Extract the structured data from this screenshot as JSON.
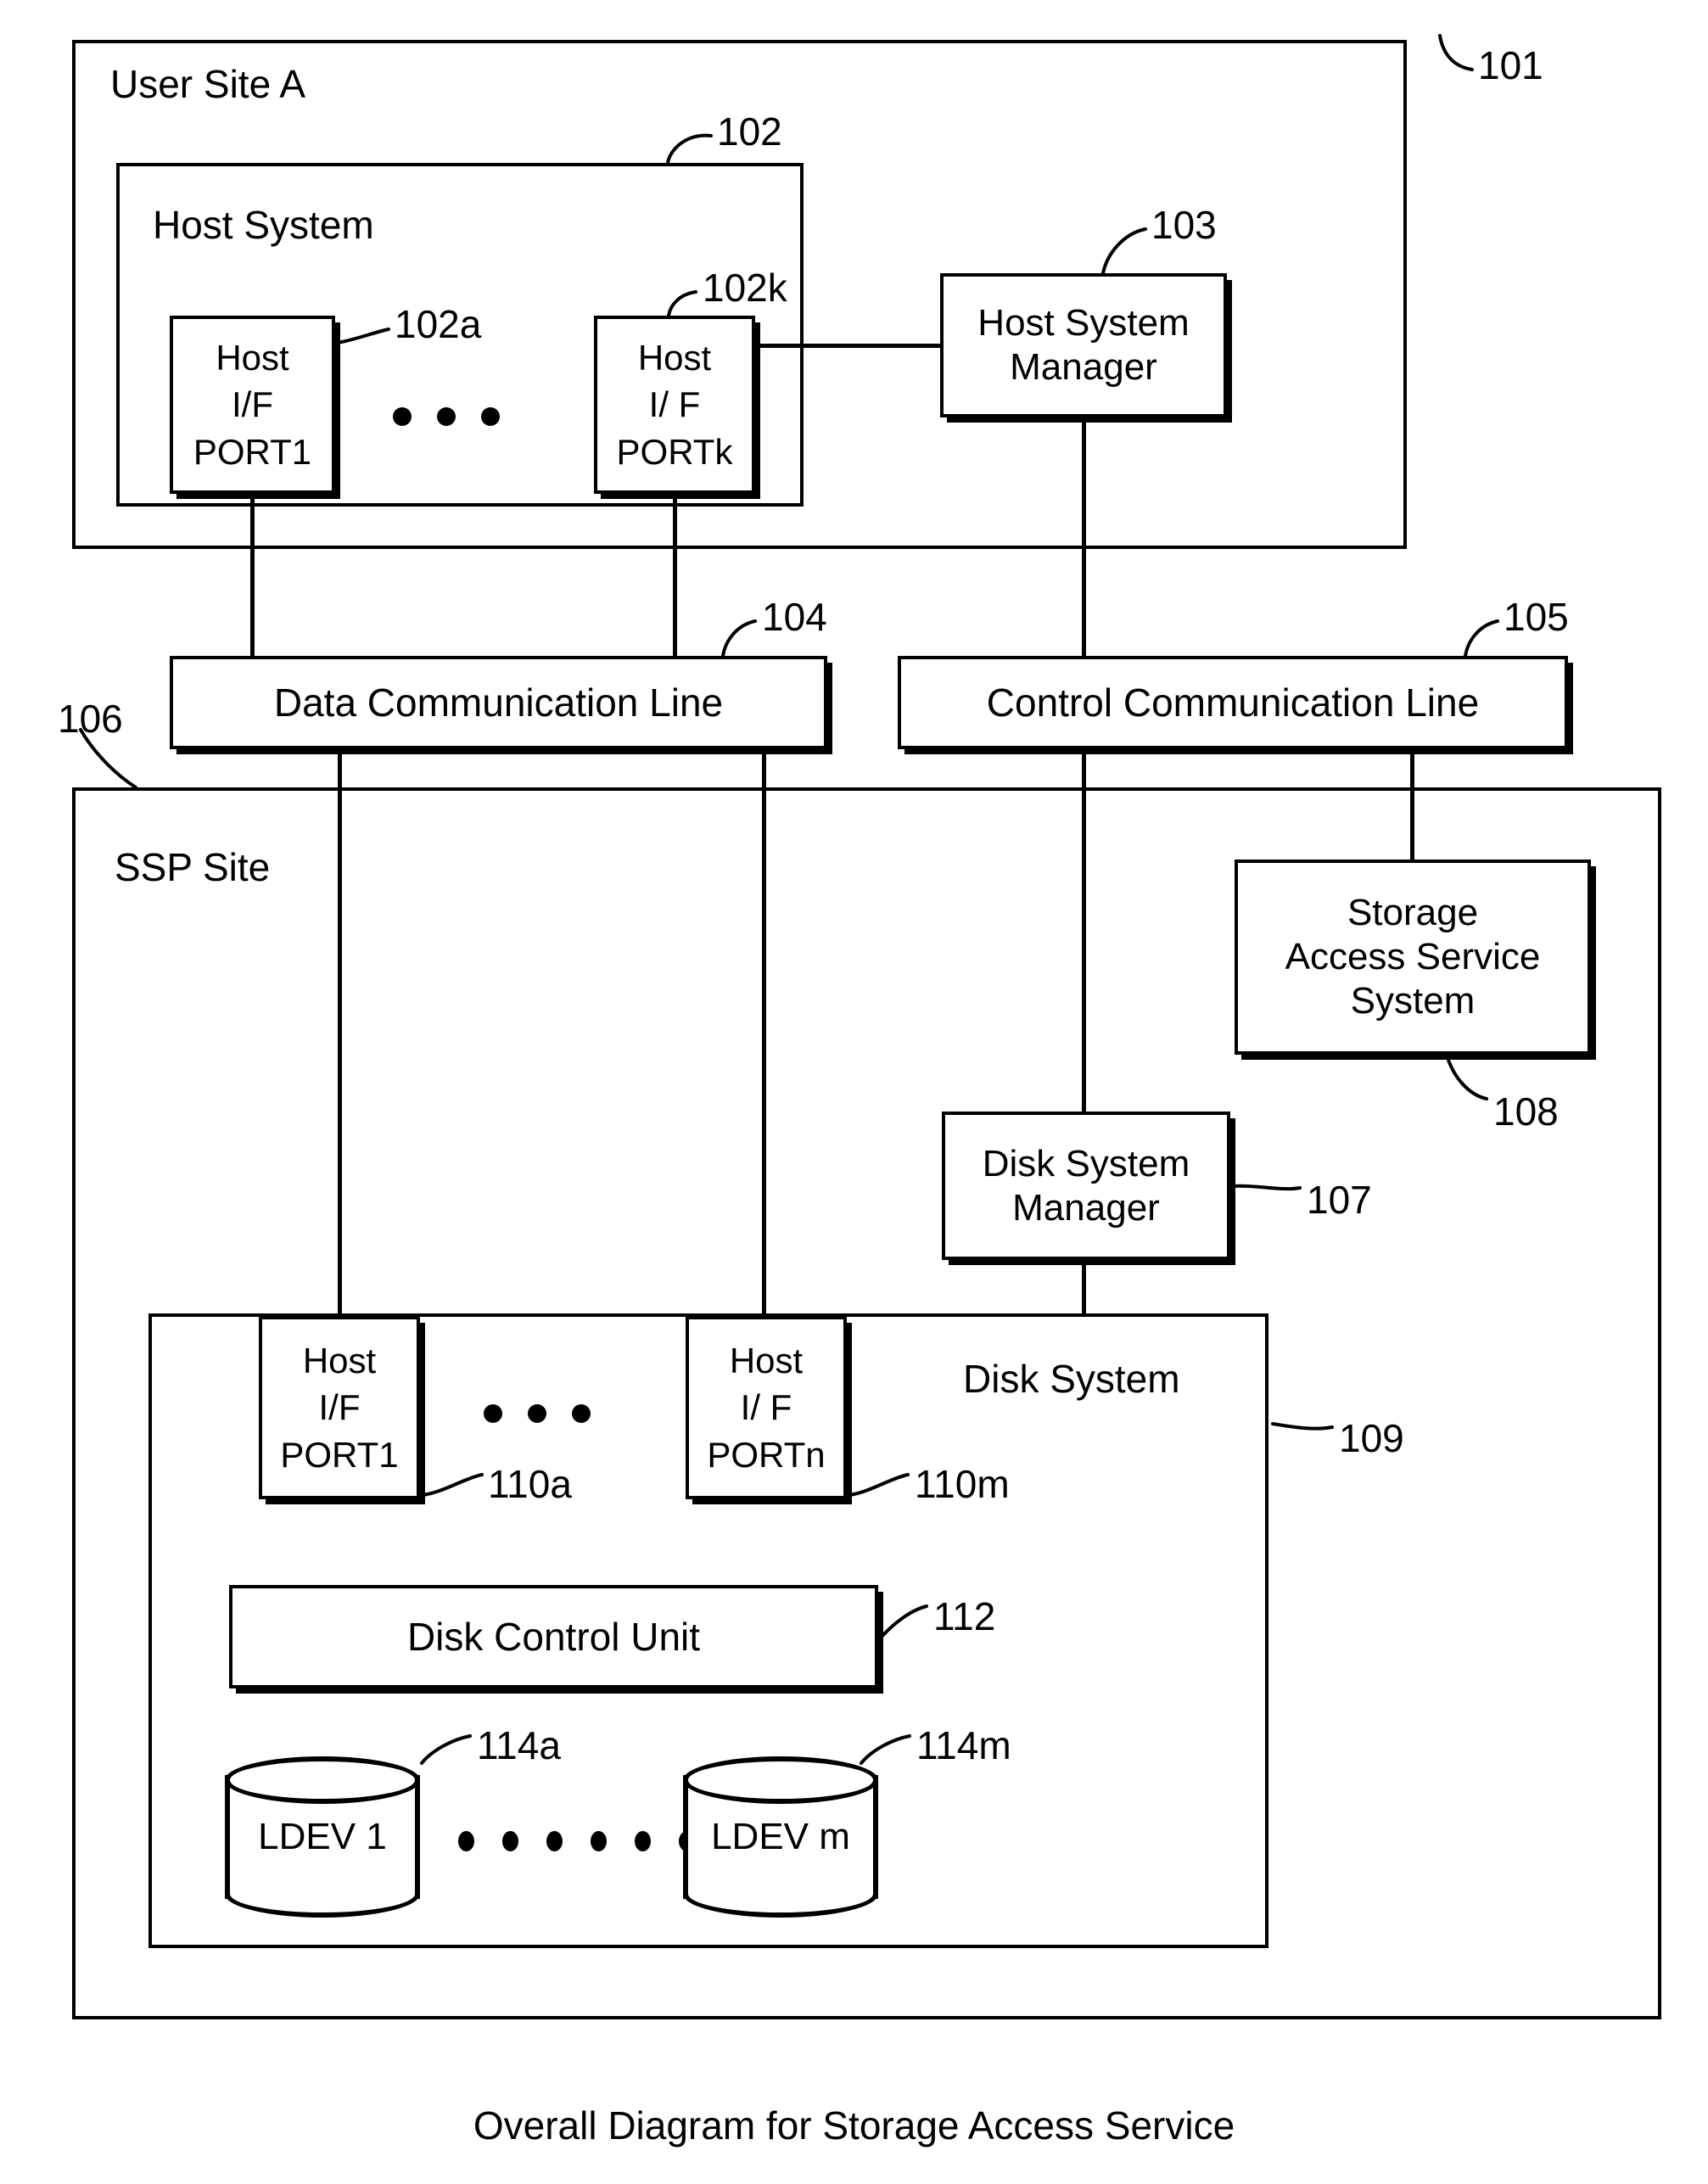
{
  "figure": {
    "caption": "Overall Diagram for Storage Access Service"
  },
  "user_site": {
    "title": "User Site A",
    "ref": "101",
    "host_system": {
      "title": "Host System",
      "ref": "102",
      "ports": [
        {
          "line1": "Host",
          "line2": "I/F",
          "line3": "PORT1",
          "ref": "102a"
        },
        {
          "line1": "Host",
          "line2": "I/ F",
          "line3": "PORTk",
          "ref": "102k"
        }
      ]
    },
    "host_system_manager": {
      "line1": "Host System",
      "line2": "Manager",
      "ref": "103"
    }
  },
  "communication_lines": [
    {
      "label": "Data Communication Line",
      "ref": "104"
    },
    {
      "label": "Control Communication Line",
      "ref": "105"
    }
  ],
  "ssp_site": {
    "title": "SSP Site",
    "ref": "106",
    "storage_access_service_system": {
      "line1": "Storage",
      "line2": "Access Service",
      "line3": "System",
      "ref": "108"
    },
    "disk_system_manager": {
      "line1": "Disk System",
      "line2": "Manager",
      "ref": "107"
    },
    "disk_system": {
      "title": "Disk System",
      "ref": "109",
      "ports": [
        {
          "line1": "Host",
          "line2": "I/F",
          "line3": "PORT1",
          "ref": "110a"
        },
        {
          "line1": "Host",
          "line2": "I/ F",
          "line3": "PORTn",
          "ref": "110m"
        }
      ],
      "disk_control_unit": {
        "label": "Disk Control Unit",
        "ref": "112"
      },
      "ldevs": [
        {
          "label": "LDEV 1",
          "ref": "114a"
        },
        {
          "label": "LDEV m",
          "ref": "114m"
        }
      ]
    }
  },
  "colors": {
    "ink": "#000000",
    "paper": "#ffffff"
  }
}
